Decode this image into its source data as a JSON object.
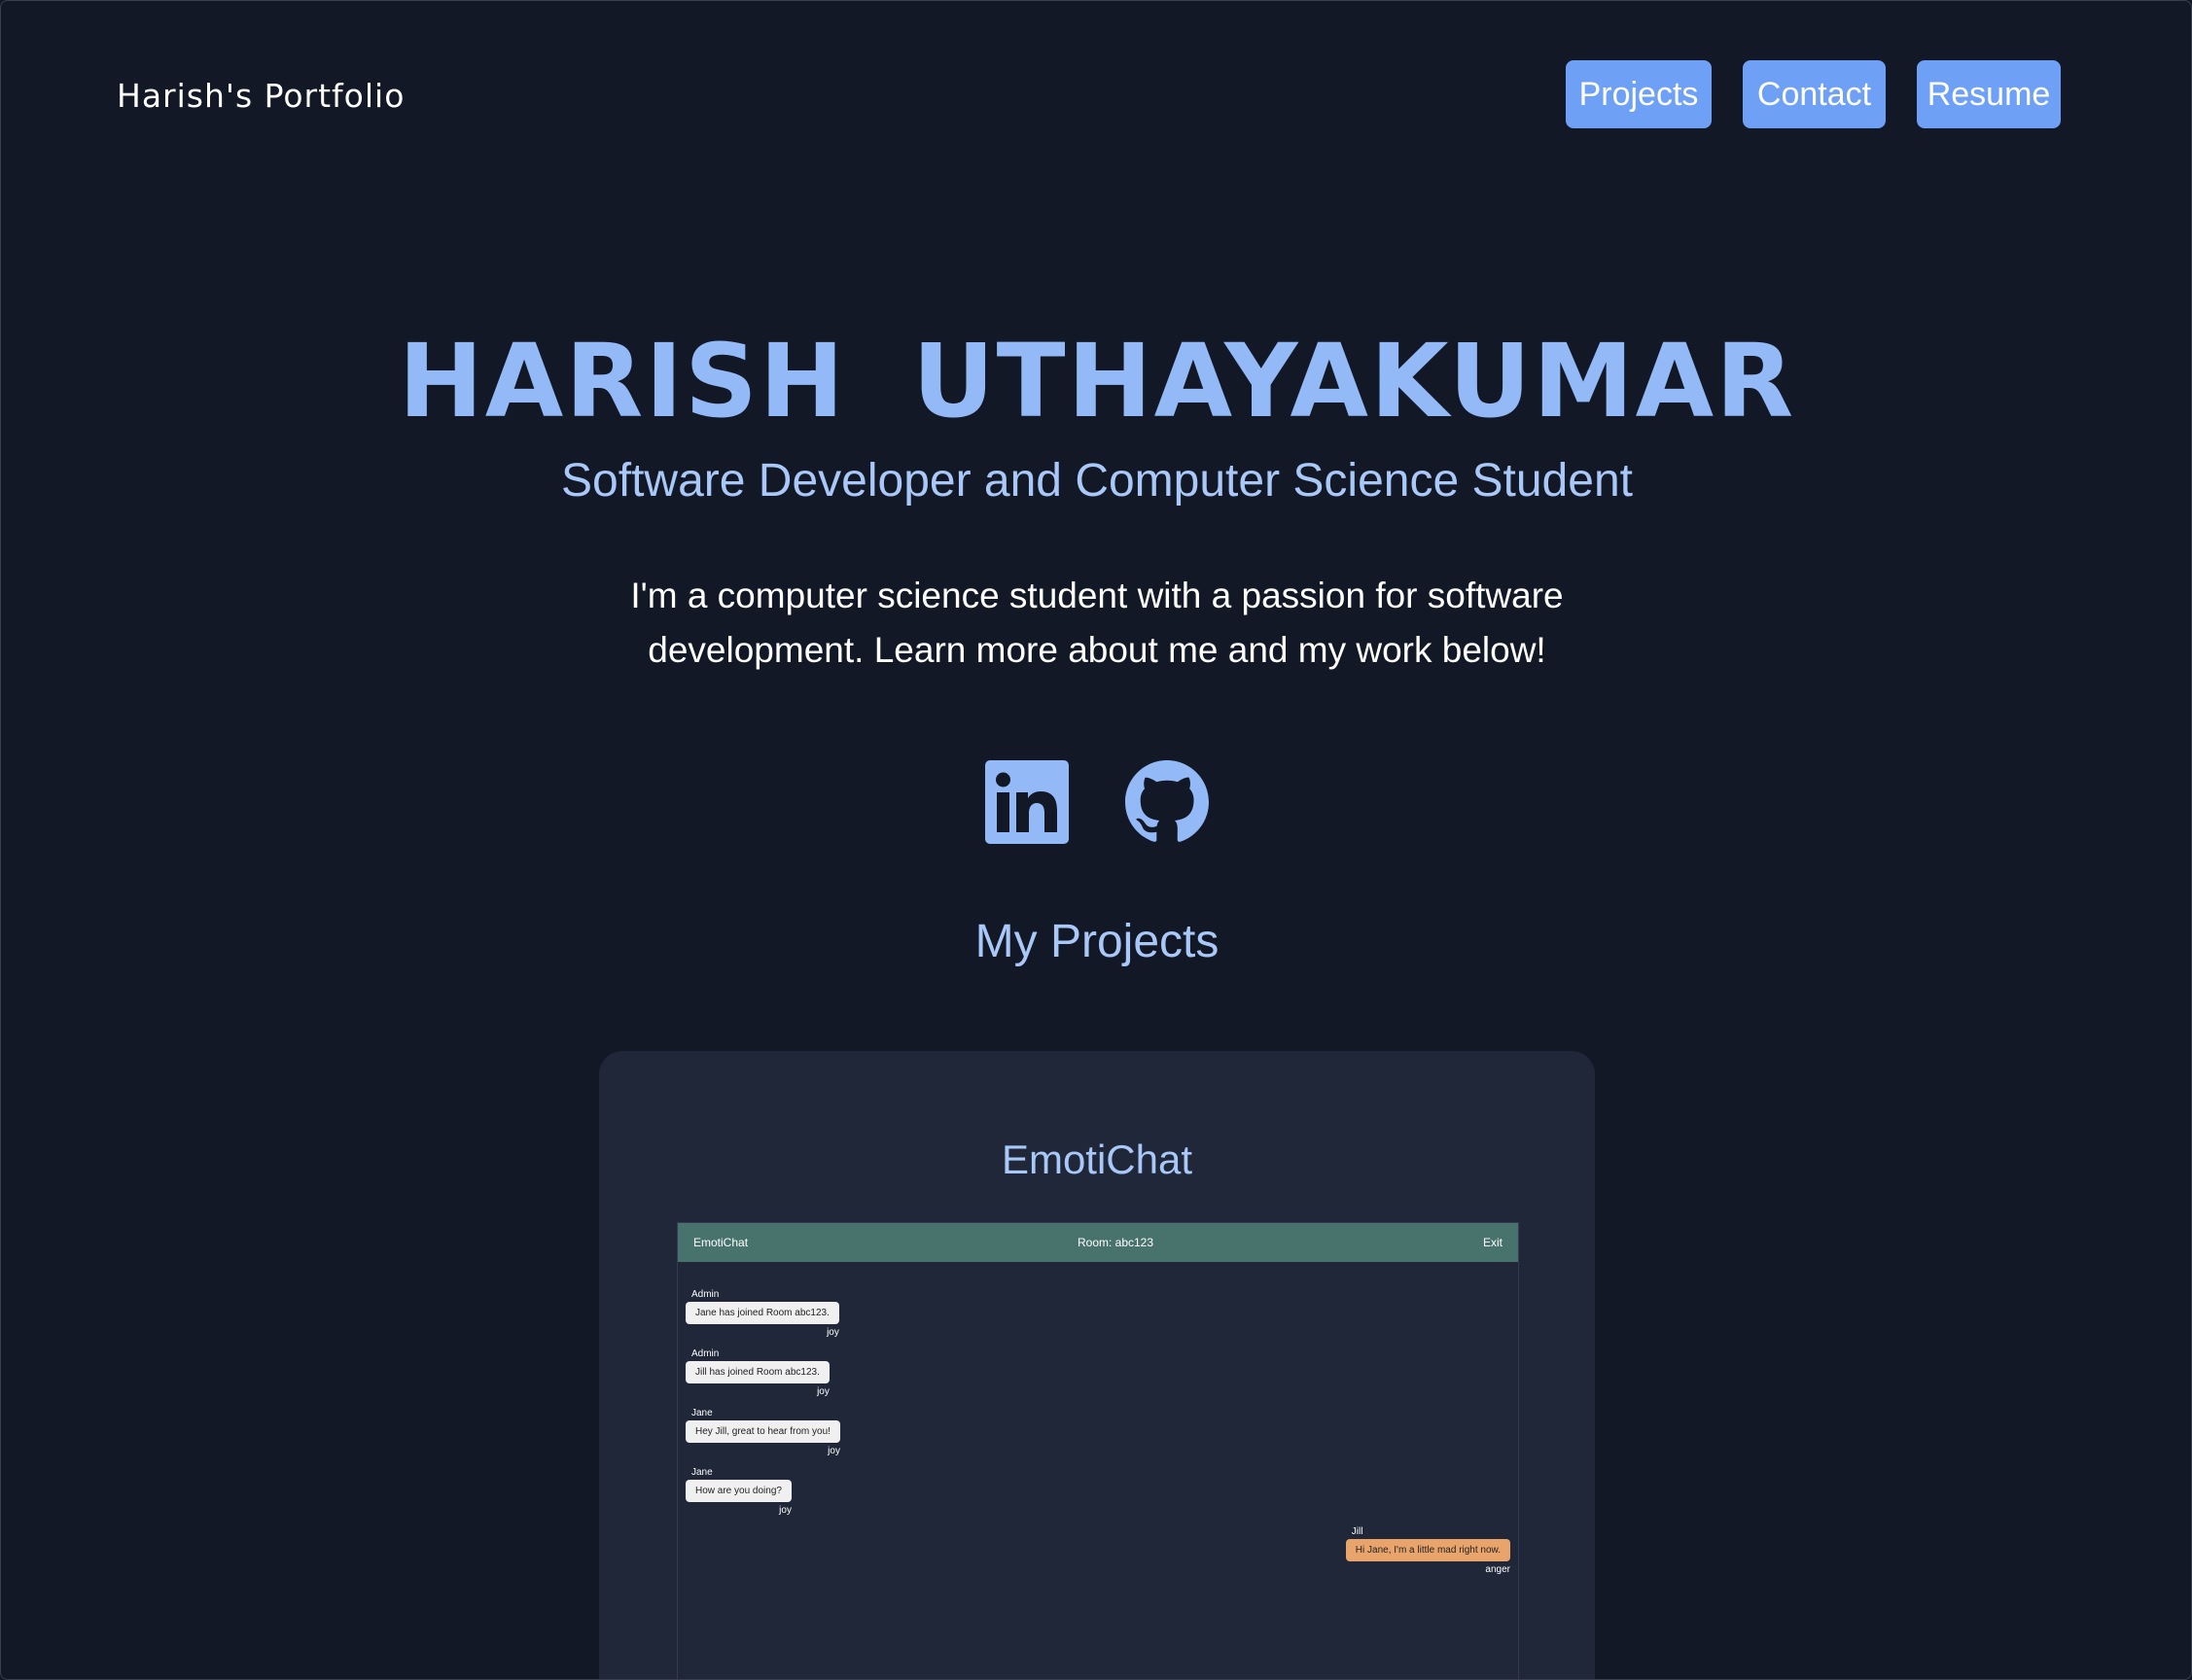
{
  "header": {
    "brand": "Harish's Portfolio",
    "nav": [
      {
        "label": "Projects"
      },
      {
        "label": "Contact"
      },
      {
        "label": "Resume"
      }
    ]
  },
  "hero": {
    "name": "HARISH UTHAYAKUMAR",
    "subtitle": "Software Developer and Computer Science Student",
    "description": "I'm a computer science student with a passion for software development. Learn more about me and my work below!",
    "social": [
      {
        "icon": "linkedin-icon"
      },
      {
        "icon": "github-icon"
      }
    ]
  },
  "projects": {
    "title": "My Projects",
    "items": [
      {
        "title": "EmotiChat",
        "screenshot": {
          "app_title": "EmotiChat",
          "room": "Room: abc123",
          "exit": "Exit",
          "messages": [
            {
              "sender": "Admin",
              "text": "Jane has joined Room abc123.",
              "emotion": "joy"
            },
            {
              "sender": "Admin",
              "text": "Jill has joined Room abc123.",
              "emotion": "joy"
            },
            {
              "sender": "Jane",
              "text": "Hey Jill, great to hear from you!",
              "emotion": "joy"
            },
            {
              "sender": "Jane",
              "text": "How are you doing?",
              "emotion": "joy"
            },
            {
              "sender": "Jill",
              "text": "Hi Jane, I'm a little mad right now.",
              "emotion": "anger"
            }
          ]
        }
      }
    ]
  },
  "colors": {
    "background": "#121826",
    "accent": "#6ea0f5",
    "heading": "#93b9f7",
    "card": "#1f2739",
    "chat_header": "#48736c",
    "own_bubble": "#e9a46b"
  }
}
